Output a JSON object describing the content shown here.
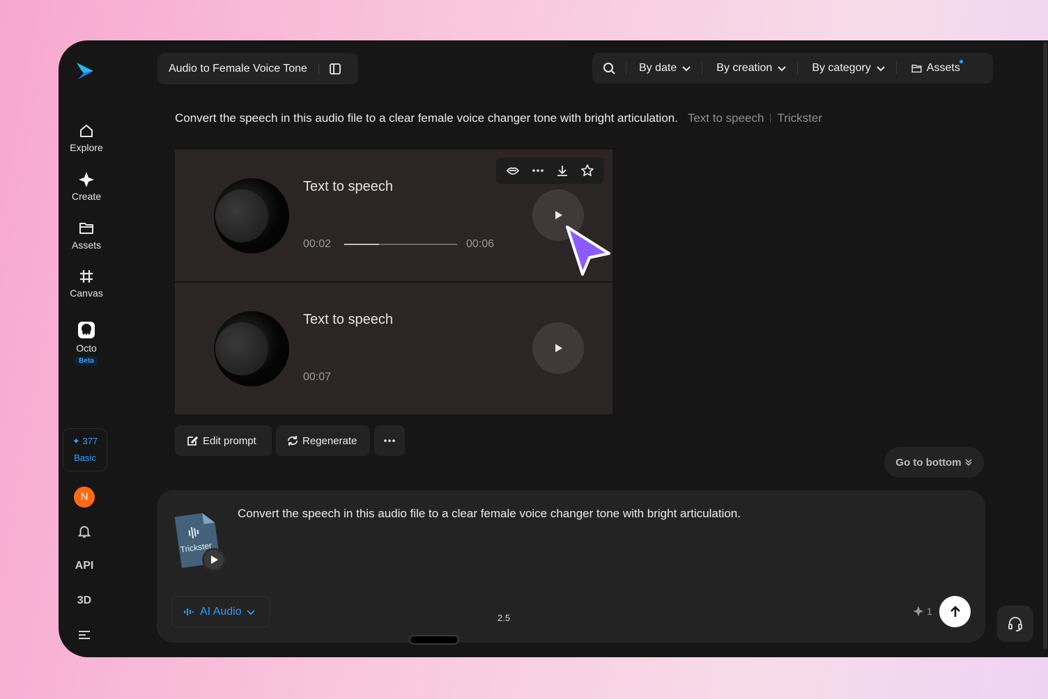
{
  "sidebar": {
    "items": [
      {
        "label": "Explore",
        "icon": "home-icon"
      },
      {
        "label": "Create",
        "icon": "sparkle-icon"
      },
      {
        "label": "Assets",
        "icon": "folder-icon"
      },
      {
        "label": "Canvas",
        "icon": "crop-icon"
      },
      {
        "label": "Octo",
        "icon": "octo-icon",
        "badge": "Beta"
      }
    ],
    "credits": {
      "value": "377",
      "plan": "Basic"
    },
    "avatar_initial": "N",
    "api_label": "API",
    "three_d_label": "3D"
  },
  "header": {
    "title": "Audio to Female Voice Tone",
    "filters": {
      "by_date": "By date",
      "by_creation": "By creation",
      "by_category": "By category",
      "assets": "Assets"
    }
  },
  "prompt": {
    "text": "Convert the speech in this audio file to a clear female voice changer tone with bright articulation.",
    "tags": [
      "Text to speech",
      "Trickster"
    ]
  },
  "cards": [
    {
      "title": "Text to speech",
      "current_time": "00:02",
      "total_time": "00:06",
      "progress": 0.31
    },
    {
      "title": "Text to speech",
      "duration": "00:07"
    }
  ],
  "actions": {
    "edit_prompt": "Edit prompt",
    "regenerate": "Regenerate"
  },
  "go_bottom": "Go to bottom",
  "composer": {
    "text": "Convert the speech in this audio file to a clear female voice changer tone with bright articulation.",
    "attachment_label": "Trickster",
    "model": "AI Audio",
    "version": "2.5",
    "cost": "1"
  },
  "colors": {
    "accent": "#2f9bff",
    "background": "#161616",
    "card": "#2c2525",
    "cursor": "#8a5cff"
  }
}
